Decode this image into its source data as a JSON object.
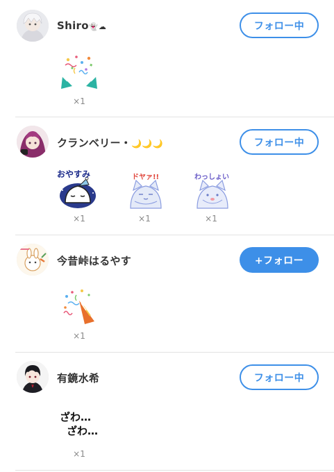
{
  "list": [
    {
      "name": "Shiro",
      "name_suffix": "👻☁",
      "button": "フォロー中",
      "following": true,
      "stamps": [
        {
          "icon": "party-popper-stamp",
          "count": "×1"
        }
      ]
    },
    {
      "name": "クランベリー・",
      "name_suffix": "🌙🌙🌙",
      "button": "フォロー中",
      "following": true,
      "stamps": [
        {
          "icon": "oyasumi-stamp",
          "label": "おやすみ",
          "count": "×1"
        },
        {
          "icon": "doya-stamp",
          "label": "ドヤァ!!",
          "count": "×1"
        },
        {
          "icon": "wasshoi-stamp",
          "label": "わっしょい",
          "count": "×1"
        }
      ]
    },
    {
      "name": "今昔峠はるやす",
      "name_suffix": "",
      "button": "+フォロー",
      "following": false,
      "stamps": [
        {
          "icon": "party-popper-stamp",
          "count": "×1"
        }
      ]
    },
    {
      "name": "有鏡水希",
      "name_suffix": "",
      "button": "フォロー中",
      "following": true,
      "stamps": [
        {
          "icon": "zawa-stamp",
          "label_line1": "ざわ…",
          "label_line2": "ざわ…",
          "count": "×1"
        }
      ]
    }
  ]
}
